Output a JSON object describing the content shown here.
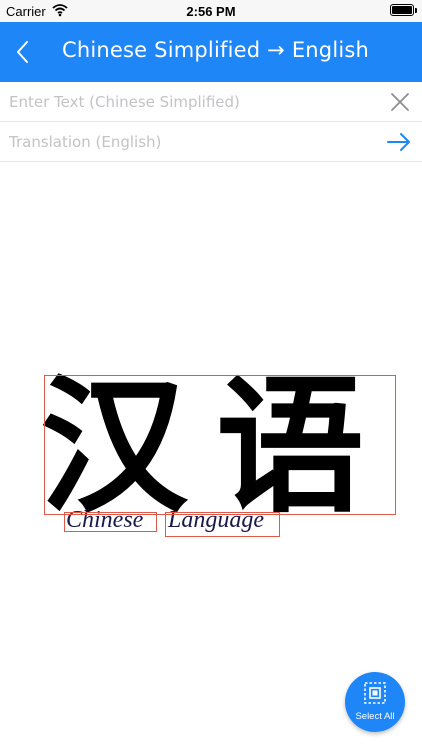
{
  "status_bar": {
    "carrier": "Carrier",
    "time": "2:56 PM",
    "wifi_icon": "wifi-icon",
    "battery_icon": "battery-icon"
  },
  "nav": {
    "title": "Chinese Simplified → English",
    "back_icon": "chevron-left-icon",
    "background": "#1f86f8"
  },
  "input": {
    "placeholder": "Enter Text (Chinese Simplified)",
    "value": "",
    "clear_icon": "close-icon"
  },
  "output": {
    "placeholder": "Translation (English)",
    "value": "",
    "go_icon": "arrow-right-icon"
  },
  "image": {
    "hanzi": "汉语",
    "word1": "Chinese",
    "word2": "Language",
    "box_color": "#e05a4a"
  },
  "fab": {
    "label": "Select All",
    "icon": "select-all-icon"
  }
}
